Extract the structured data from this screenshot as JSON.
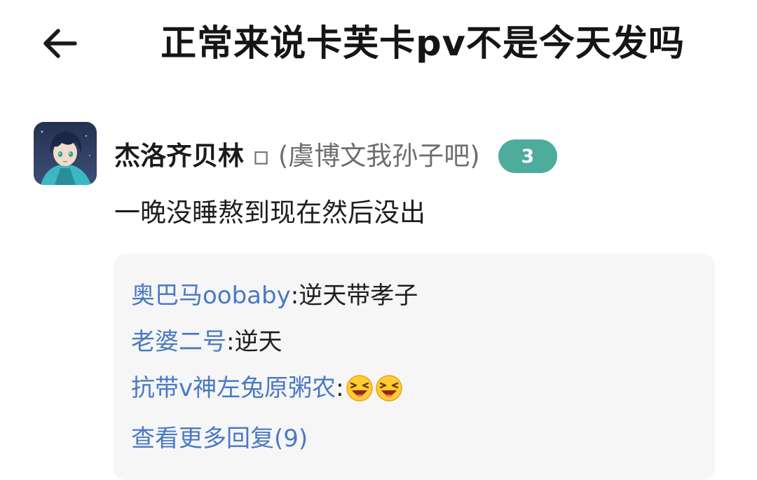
{
  "header": {
    "title": "正常来说卡芙卡pv不是今天发吗",
    "back_icon": "arrow-left-icon"
  },
  "post": {
    "username": "杰洛齐贝林",
    "user_tag": "▫ (虞博文我孙子吧)",
    "level": "3",
    "level_color": "#4dac9b",
    "content": "一晚没睡熬到现在然后没出"
  },
  "replies": [
    {
      "author": "奥巴马oobaby",
      "separator": ":",
      "text": "逆天带孝子"
    },
    {
      "author": "老婆二号",
      "separator": ":",
      "text": "逆天"
    },
    {
      "author": "抗带v神左兔原粥农",
      "separator": ":",
      "text": "",
      "emojis": [
        "laughing-face-emoji",
        "laughing-face-emoji"
      ]
    }
  ],
  "more_replies_label": "查看更多回复(9)",
  "colors": {
    "link_blue": "#4a79c4",
    "reply_bg": "#f6f6f6"
  }
}
